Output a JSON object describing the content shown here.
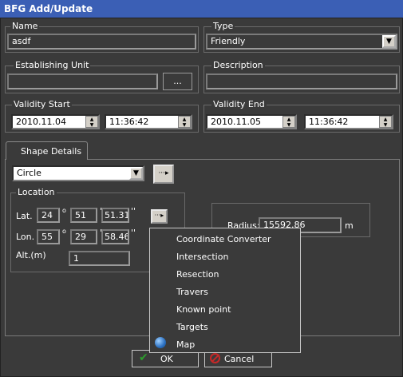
{
  "window": {
    "title": "BFG Add/Update"
  },
  "name": {
    "label": "Name",
    "value": "asdf"
  },
  "type": {
    "label": "Type",
    "value": "Friendly"
  },
  "establishing_unit": {
    "label": "Establishing Unit",
    "value": "",
    "browse_label": "..."
  },
  "description": {
    "label": "Description",
    "value": ""
  },
  "validity_start": {
    "label": "Validity Start",
    "date": "2010.11.04",
    "time": "11:36:42"
  },
  "validity_end": {
    "label": "Validity End",
    "date": "2010.11.05",
    "time": "11:36:42"
  },
  "tab": {
    "label": "Shape Details"
  },
  "shape": {
    "value": "Circle"
  },
  "location": {
    "label": "Location",
    "lat_label": "Lat.",
    "lat_deg": "24",
    "lat_min": "51",
    "lat_sec": "51.31",
    "lon_label": "Lon.",
    "lon_deg": "55",
    "lon_min": "29",
    "lon_sec": "58.46",
    "alt_label": "Alt.(m)",
    "alt_value": "1",
    "deg_symbol": "o",
    "min_symbol": "'",
    "sec_symbol": "''"
  },
  "radius": {
    "label": "Radius:",
    "value": "15592.86",
    "unit": "m"
  },
  "context_menu": {
    "items": [
      "Coordinate Converter",
      "Intersection",
      "Resection",
      "Travers",
      "Known point",
      "Targets",
      "Map"
    ]
  },
  "footer": {
    "ok_label": "OK",
    "cancel_label": "Cancel"
  },
  "colors": {
    "title_bar": "#3b5fb5",
    "background": "#3a3a3a",
    "ok_check": "#2e9e2e",
    "cancel_icon": "#c62828"
  }
}
